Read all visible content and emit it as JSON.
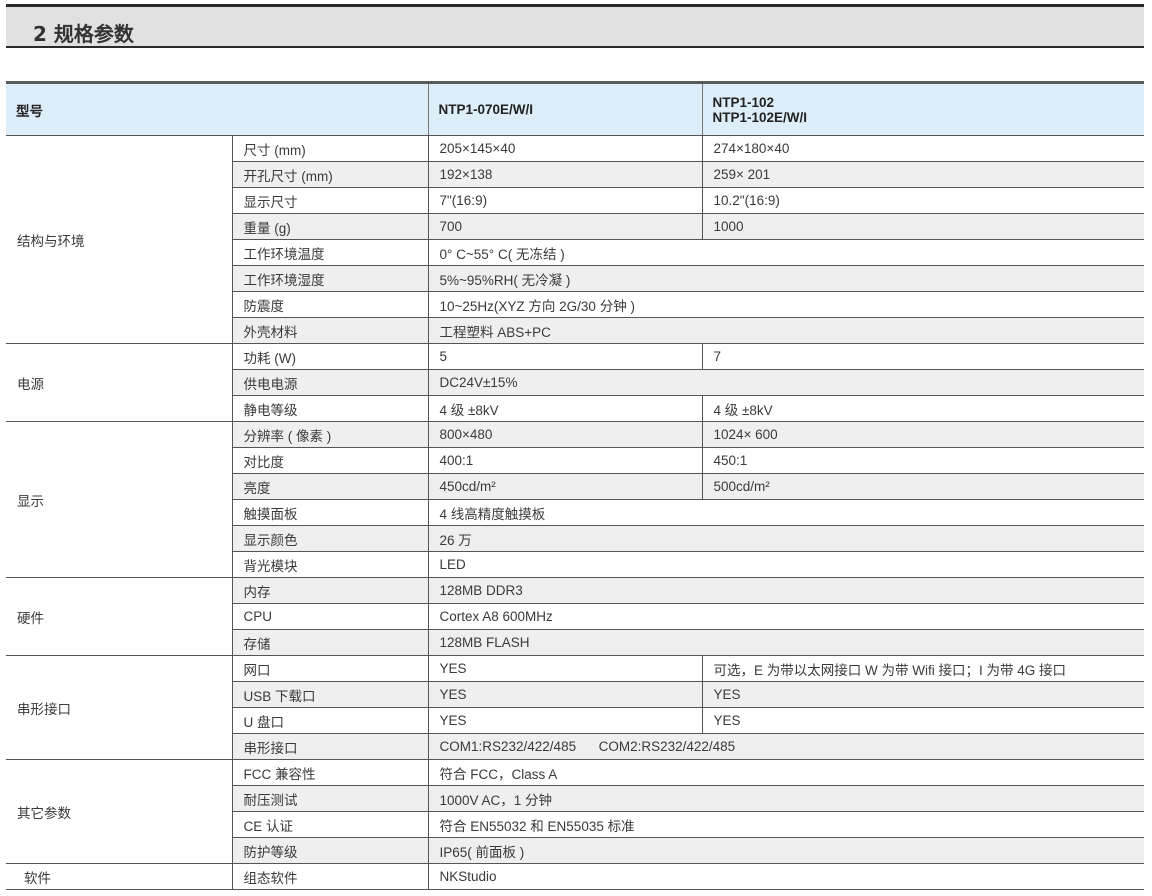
{
  "section": {
    "title": "2 规格参数"
  },
  "header": {
    "col_model": "型号",
    "col_a": "NTP1-070E/W/I",
    "col_b_line1": "NTP1-102",
    "col_b_line2": "NTP1-102E/W/I"
  },
  "groups": [
    {
      "name": "结构与环境",
      "rows": [
        {
          "item": "尺寸 (mm)",
          "a": "205×145×40",
          "b": "274×180×40"
        },
        {
          "item": "开孔尺寸 (mm)",
          "a": "192×138",
          "b": "259× 201"
        },
        {
          "item": "显示尺寸",
          "a": "7\"(16:9)",
          "b": "10.2\"(16:9)"
        },
        {
          "item": "重量 (g)",
          "a": "700",
          "b": "1000"
        },
        {
          "item": "工作环境温度",
          "a": "0° C~55° C( 无冻结 )"
        },
        {
          "item": "工作环境湿度",
          "a": "5%~95%RH( 无冷凝 )"
        },
        {
          "item": "防震度",
          "a": "10~25Hz(XYZ 方向 2G/30 分钟 )"
        },
        {
          "item": "外壳材料",
          "a": "工程塑料 ABS+PC"
        }
      ]
    },
    {
      "name": "电源",
      "rows": [
        {
          "item": "功耗 (W)",
          "a": "5",
          "b": "7"
        },
        {
          "item": "供电电源",
          "a": "DC24V±15%"
        },
        {
          "item": "静电等级",
          "a": "4 级 ±8kV",
          "b": "4 级 ±8kV"
        }
      ]
    },
    {
      "name": "显示",
      "rows": [
        {
          "item": "分辨率 ( 像素 )",
          "a": "800×480",
          "b": "1024× 600"
        },
        {
          "item": "对比度",
          "a": "400:1",
          "b": "450:1"
        },
        {
          "item": "亮度",
          "a": "450cd/m²",
          "b": "500cd/m²"
        },
        {
          "item": "触摸面板",
          "a": "4 线高精度触摸板"
        },
        {
          "item": "显示颜色",
          "a": "26 万"
        },
        {
          "item": "背光模块",
          "a": "LED"
        }
      ]
    },
    {
      "name": "硬件",
      "rows": [
        {
          "item": "内存",
          "a": "128MB DDR3"
        },
        {
          "item": "CPU",
          "a": "Cortex A8 600MHz"
        },
        {
          "item": "存储",
          "a": "128MB FLASH"
        }
      ]
    },
    {
      "name": "串形接口",
      "rows": [
        {
          "item": "网口",
          "a": "YES",
          "b": "可选，E 为带以太网接口 W 为带 Wifi 接口；I 为带 4G 接口"
        },
        {
          "item": "USB 下载口",
          "a": "YES",
          "b": "YES"
        },
        {
          "item": "U 盘口",
          "a": "YES",
          "b": "YES"
        },
        {
          "item": "串形接口",
          "a": "COM1:RS232/422/485      COM2:RS232/422/485"
        }
      ]
    },
    {
      "name": "其它参数",
      "rows": [
        {
          "item": "FCC 兼容性",
          "a": "符合 FCC，Class A"
        },
        {
          "item": "耐压测试",
          "a": "1000V AC，1 分钟"
        },
        {
          "item": "CE 认证",
          "a": "符合 EN55032 和 EN55035 标准"
        },
        {
          "item": "防护等级",
          "a": "IP65( 前面板 )"
        }
      ]
    },
    {
      "name": "软件",
      "rows": [
        {
          "item": "组态软件",
          "a": "NKStudio"
        }
      ]
    }
  ]
}
